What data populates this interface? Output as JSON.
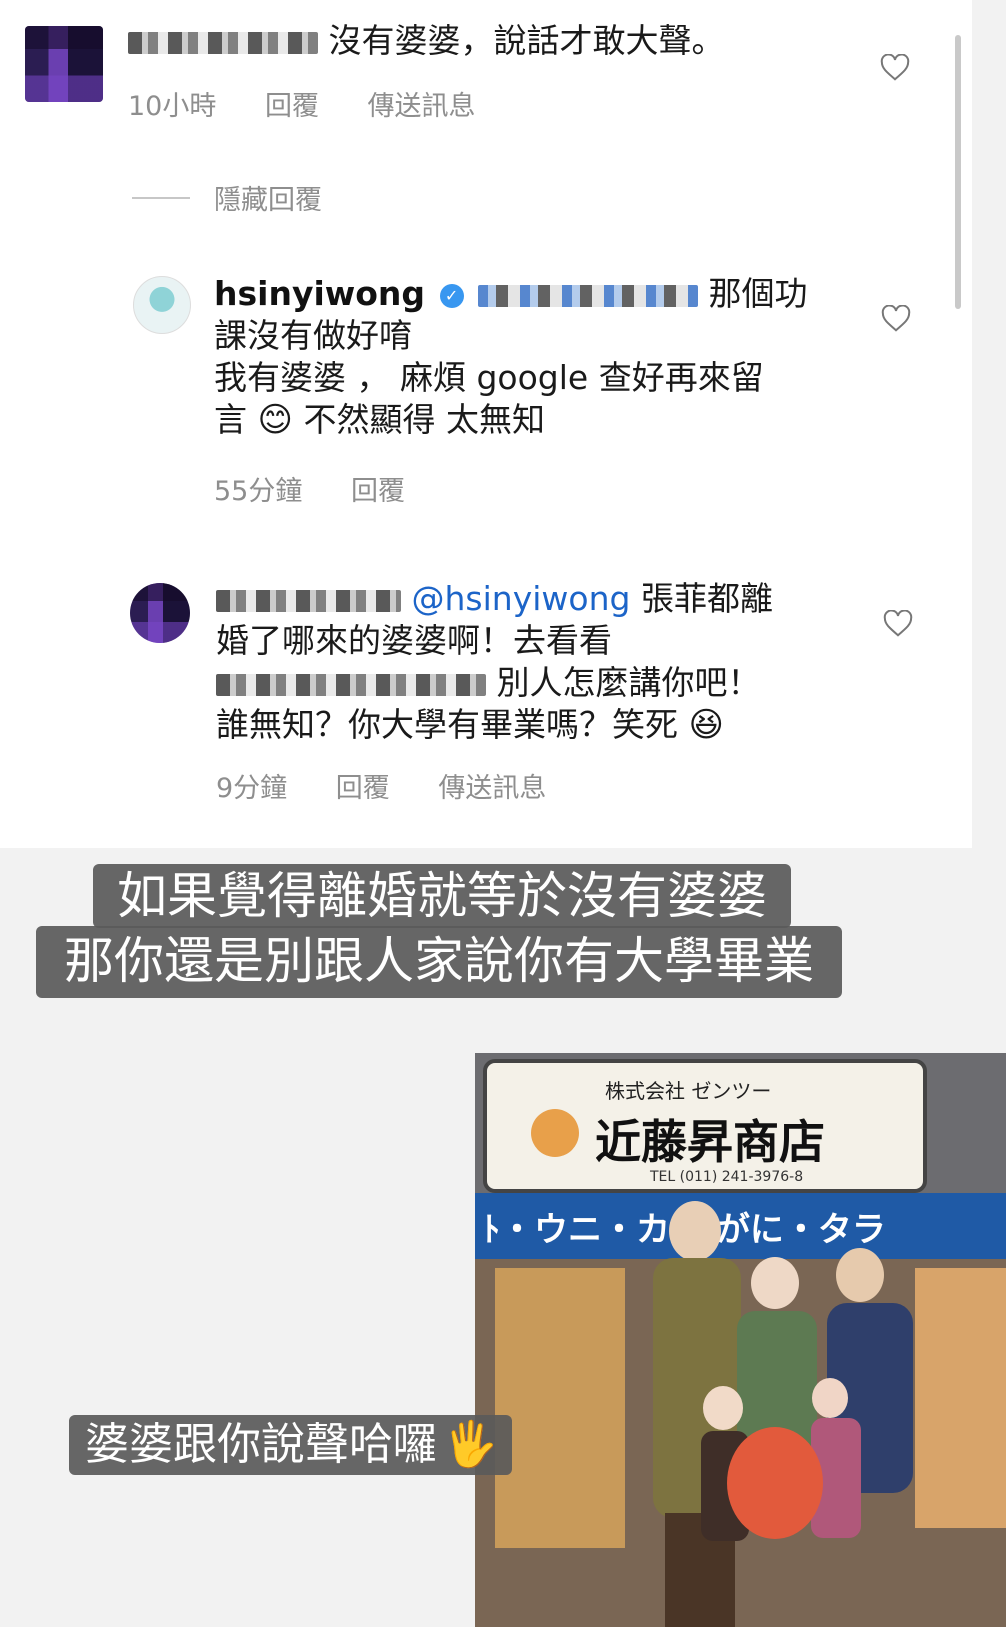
{
  "comments": [
    {
      "username_redacted": true,
      "text": "沒有婆婆，說話才敢大聲。",
      "time": "10小時",
      "reply_label": "回覆",
      "message_label": "傳送訊息"
    },
    {
      "username": "hsinyiwong",
      "text_head": "那個功",
      "text_line2": "課沒有做好唷",
      "text_line3": "我有婆婆 ， 麻煩 google 查好再來留",
      "text_line4a": "言",
      "emoji": "😊",
      "text_line4b": "不然顯得 太無知",
      "time": "55分鐘",
      "reply_label": "回覆"
    },
    {
      "mention": "@hsinyiwong",
      "text_head": "張菲都離",
      "text_line2": "婚了哪來的婆婆啊！去看看",
      "text_line3b": "別人怎麼講你吧！",
      "text_line4": "誰無知？你大學有畢業嗎？笑死",
      "emoji": "😆",
      "time": "9分鐘",
      "reply_label": "回覆",
      "message_label": "傳送訊息"
    }
  ],
  "hide_replies_label": "隱藏回覆",
  "captions": {
    "main_line1": "如果覺得離婚就等於沒有婆婆",
    "main_line2": "那你還是別跟人家說你有大學畢業",
    "photo_caption": "婆婆跟你說聲哈囉",
    "photo_caption_emoji": "🖐"
  },
  "photo": {
    "sign_top": "株式会社 ゼンツー",
    "sign_main": "近藤昇商店",
    "sign_tel": "TEL (011) 241-3976-8",
    "banner": "ﾄ・ウニ・カ 毛がに・タラ"
  }
}
